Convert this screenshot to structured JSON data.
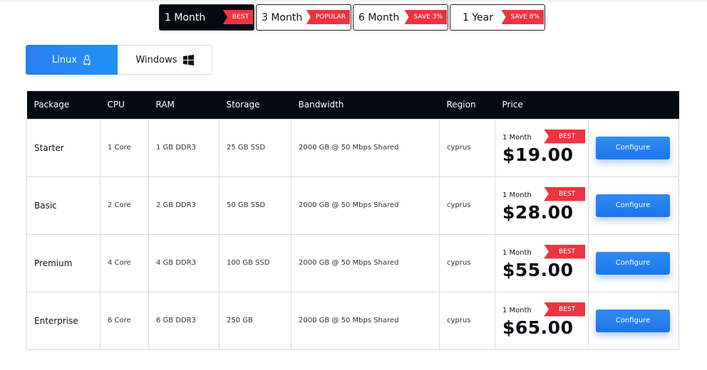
{
  "period_tabs": [
    {
      "label": "1 Month",
      "badge": "BEST",
      "active": true
    },
    {
      "label": "3 Month",
      "badge": "POPULAR",
      "active": false
    },
    {
      "label": "6 Month",
      "badge": "SAVE 3%",
      "active": false
    },
    {
      "label": "1 Year",
      "badge": "SAVE 8%",
      "active": false
    }
  ],
  "os_tabs": {
    "linux": {
      "label": "Linux",
      "icon": "linux-icon",
      "active": true
    },
    "windows": {
      "label": "Windows",
      "icon": "windows-icon",
      "active": false
    }
  },
  "table": {
    "headers": [
      "Package",
      "CPU",
      "RAM",
      "Storage",
      "Bandwidth",
      "Region",
      "Price",
      ""
    ],
    "rows": [
      {
        "package": "Starter",
        "cpu": "1 Core",
        "ram": "1 GB DDR3",
        "storage": "25 GB SSD",
        "bandwidth": "2000 GB @ 50 Mbps Shared",
        "region": "cyprus",
        "period": "1 Month",
        "badge": "BEST",
        "price": "$19.00",
        "button": "Configure"
      },
      {
        "package": "Basic",
        "cpu": "2 Core",
        "ram": "2 GB DDR3",
        "storage": "50 GB SSD",
        "bandwidth": "2000 GB @ 50 Mbps Shared",
        "region": "cyprus",
        "period": "1 Month",
        "badge": "BEST",
        "price": "$28.00",
        "button": "Configure"
      },
      {
        "package": "Premium",
        "cpu": "4 Core",
        "ram": "4 GB DDR3",
        "storage": "100 GB SSD",
        "bandwidth": "2000 GB @ 50 Mbps Shared",
        "region": "cyprus",
        "period": "1 Month",
        "badge": "BEST",
        "price": "$55.00",
        "button": "Configure"
      },
      {
        "package": "Enterprise",
        "cpu": "6 Core",
        "ram": "6 GB DDR3",
        "storage": "250 GB",
        "bandwidth": "2000 GB @ 50 Mbps Shared",
        "region": "cyprus",
        "period": "1 Month",
        "badge": "BEST",
        "price": "$65.00",
        "button": "Configure"
      }
    ]
  },
  "colors": {
    "accent": "#1f85f2",
    "badge": "#ef3340",
    "header_bg": "#050a12"
  }
}
